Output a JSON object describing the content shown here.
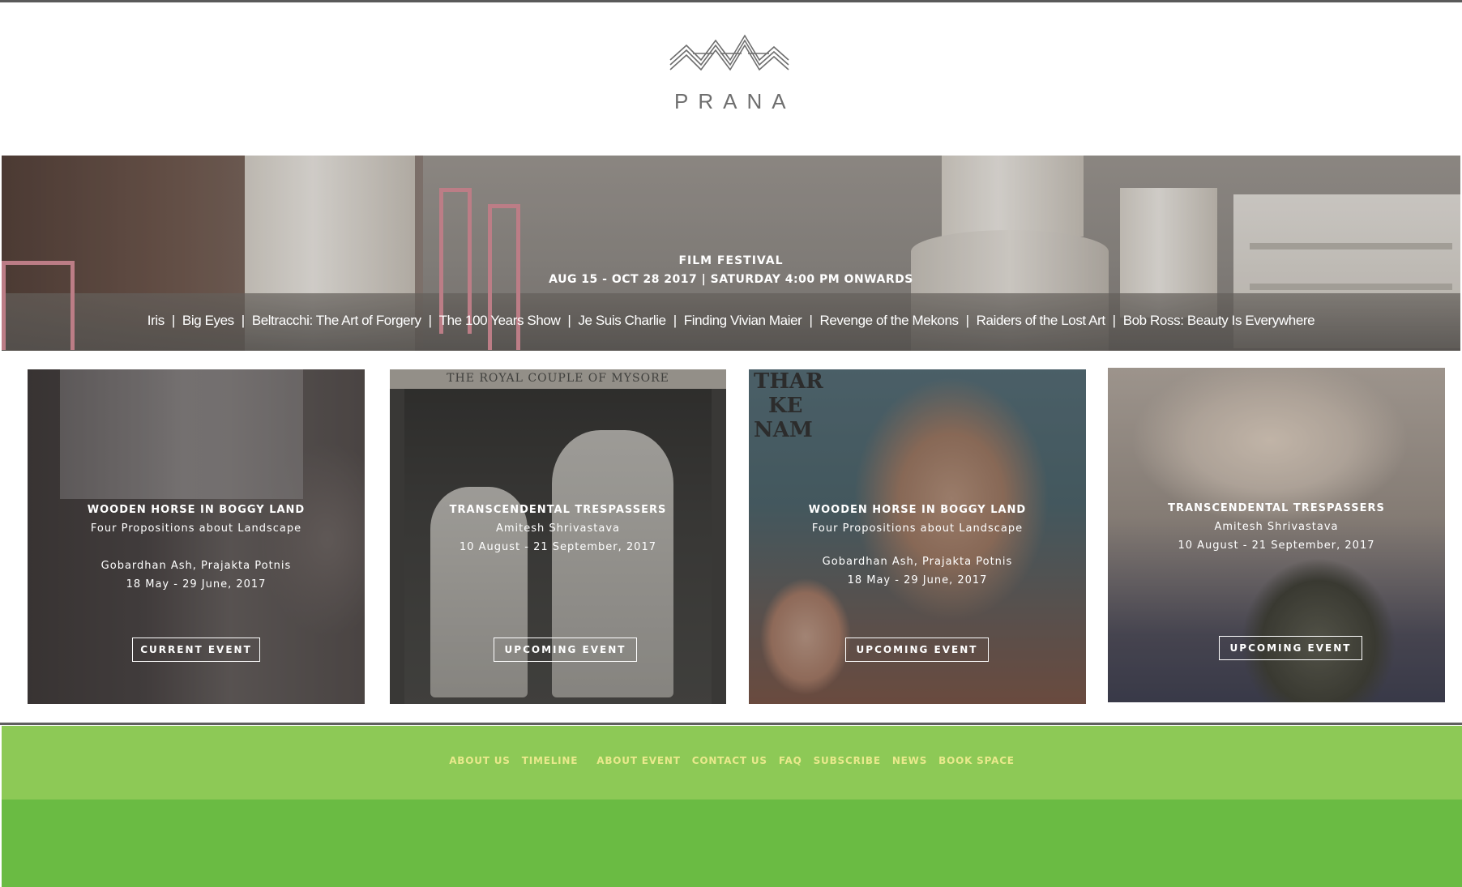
{
  "header": {
    "logo_text": "PRANA",
    "logo_icon": "prana-wave-logo-icon"
  },
  "hero": {
    "title": "FILM FESTIVAL",
    "subtitle": "AUG 15 - OCT 28 2017 | SATURDAY 4:00 PM ONWARDS",
    "films": [
      "Iris",
      "Big Eyes",
      "Beltracchi: The Art of Forgery",
      "The 100 Years Show",
      "Je Suis Charlie",
      "Finding Vivian Maier",
      "Revenge of the Mekons",
      "Raiders of the Lost Art",
      "Bob Ross: Beauty Is Everywhere"
    ],
    "separator": "|"
  },
  "cards": [
    {
      "title": "WOODEN HORSE IN BOGGY LAND",
      "subtitle": "Four Propositions about Landscape",
      "artists": "Gobardhan Ash, Prajakta Potnis",
      "dates": "18 May - 29 June, 2017",
      "button": "CURRENT EVENT"
    },
    {
      "title": "TRANSCENDENTAL TRESPASSERS",
      "subtitle": "Amitesh Shrivastava",
      "dates": "10 August - 21 September, 2017",
      "button": "UPCOMING EVENT",
      "image_caption": "THE ROYAL COUPLE OF MYSORE"
    },
    {
      "title": "WOODEN HORSE IN BOGGY LAND",
      "subtitle": "Four Propositions about Landscape",
      "artists": "Gobardhan Ash, Prajakta Potnis",
      "dates": "18 May - 29 June, 2017",
      "button": "UPCOMING EVENT",
      "image_caption_line1": "THAR",
      "image_caption_line2": "KE",
      "image_caption_line3": "NAM"
    },
    {
      "title": "TRANSCENDENTAL TRESPASSERS",
      "subtitle": "Amitesh Shrivastava",
      "dates": "10 August - 21 September, 2017",
      "button": "UPCOMING EVENT"
    }
  ],
  "footer": {
    "nav": [
      "ABOUT US",
      "TIMELINE",
      "ABOUT EVENT",
      "CONTACT US",
      "FAQ",
      "SUBSCRIBE",
      "NEWS",
      "BOOK SPACE"
    ]
  },
  "colors": {
    "footer_nav_bg": "#8dc956",
    "footer_bottom_bg": "#6abb43",
    "footer_link": "#e9e98c",
    "logo_gray": "#6e6e6e"
  }
}
